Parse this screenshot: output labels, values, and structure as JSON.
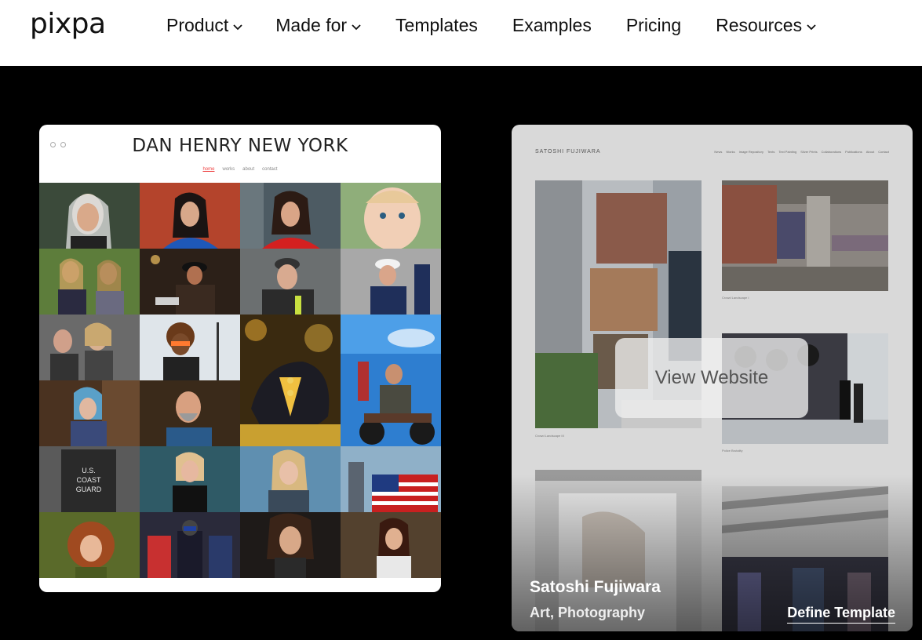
{
  "brand": {
    "logo_text": "pixpa"
  },
  "nav": {
    "items": [
      {
        "label": "Product",
        "has_dropdown": true
      },
      {
        "label": "Made for",
        "has_dropdown": true
      },
      {
        "label": "Templates",
        "has_dropdown": false
      },
      {
        "label": "Examples",
        "has_dropdown": false
      },
      {
        "label": "Pricing",
        "has_dropdown": false
      },
      {
        "label": "Resources",
        "has_dropdown": true
      }
    ]
  },
  "cards": [
    {
      "site_title": "DAN HENRY NEW YORK",
      "site_menu": [
        "home",
        "works",
        "about",
        "contact"
      ],
      "active_menu": "home"
    },
    {
      "site_title": "SATOSHI FUJIWARA",
      "site_menu": [
        "News",
        "Works",
        "Image Repository",
        "Texts",
        "Text Painting",
        "Silver Prints",
        "Collaborations",
        "Publications",
        "About",
        "Contact"
      ],
      "captions": [
        "Crowd Landscape I",
        "Crowd Landscape III",
        "Police Brutality"
      ],
      "overlay_button": "View Website",
      "name": "Satoshi Fujiwara",
      "categories": "Art, Photography",
      "action_link": "Define Template"
    }
  ],
  "colors": {
    "page_bg": "#000000",
    "nav_bg": "#ffffff",
    "card2_bg": "#d9d9d9",
    "active_menu": "#e44444"
  }
}
